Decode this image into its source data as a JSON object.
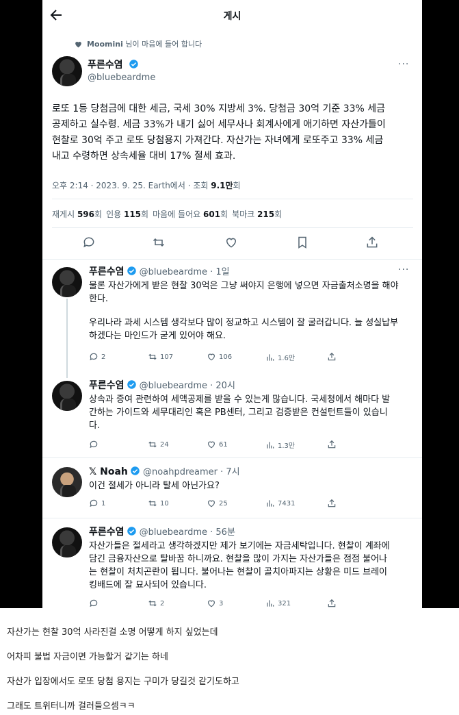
{
  "header": {
    "title": "게시"
  },
  "liked_banner": {
    "user": "Moomini",
    "suffix": "님이 마음에 들어 합니다"
  },
  "main_tweet": {
    "name": "푸른수염",
    "handle": "@bluebeardme",
    "lines": [
      "로또 1등 당첨금에 대한 세금, 국세 30% 지방세 3%. 당첨금 30억 기준 33% 세금",
      "공제하고 실수령. 세금 33%가 내기 싫어 세무사나 회계사에게 애기하면 자산가들이",
      "현찰로 30억 주고 로또 당첨용지 가져간다. 자산가는 자녀에게 로또주고 33% 세금",
      "내고 수령하면 상속세율 대비 17% 절세 효과."
    ],
    "meta_prefix": "오후 2:14 · 2023. 9. 25. Earth에서 · 조회 ",
    "views": "9.1만",
    "views_suffix": "회",
    "stats": {
      "retweet_label": "재게시",
      "retweet_count": "596",
      "retweet_unit": "회",
      "quote_label": "인용",
      "quote_count": "115",
      "quote_unit": "회",
      "like_label": "마음에 들어요",
      "like_count": "601",
      "like_unit": "회",
      "bookmark_label": "북마크",
      "bookmark_count": "215",
      "bookmark_unit": "회"
    }
  },
  "replies": [
    {
      "name": "푸른수염",
      "handle_time": "@bluebeardme · 1일",
      "lines": [
        "물론 자산가에게 받은 현찰 30억은 그냥 써야지 은행에 넣으면 자금출처소명을 해야",
        "한다.",
        "",
        "우리나라 과세 시스템 생각보다 많이 정교하고 시스템이 잘 굴러갑니다. 늘 성실납부",
        "하겠다는 마인드가 굳게 있어야 해요."
      ],
      "counts": {
        "reply": "2",
        "retweet": "107",
        "like": "106",
        "views": "1.6만"
      }
    },
    {
      "name": "푸른수염",
      "handle_time": "@bluebeardme · 20시",
      "lines": [
        "상속과 증여 관련하여 세액공제를 받을 수 있는게 많습니다. 국세청에서 해마다 발",
        "간하는 가이드와 세무대리인 혹은 PB센터, 그리고 검증받은 컨설턴트들이 있습니",
        "다."
      ],
      "counts": {
        "reply": "",
        "retweet": "24",
        "like": "61",
        "views": "1.3만"
      }
    },
    {
      "name": "𝕏 Noah",
      "handle_time": "@noahpdreamer · 7시",
      "lines": [
        "이건 절세가 아니라 탈세 아닌가요?"
      ],
      "counts": {
        "reply": "1",
        "retweet": "10",
        "like": "25",
        "views": "7431"
      }
    },
    {
      "name": "푸른수염",
      "handle_time": "@bluebeardme · 56분",
      "lines": [
        "자산가들은 절세라고 생각하겠지만 제가 보기에는 자금세탁입니다. 현찰이 계좌에",
        "담긴 금융자산으로 탈바꿈 하니까요. 현찰을 많이 가지는 자산가들은 점점 불어나",
        "는 현찰이 처치곤란이 됩니다. 불어나는 현찰이 골치아파지는 상황은 미드 브레이",
        "킹배드에 잘 묘사되어 있습니다."
      ],
      "counts": {
        "reply": "",
        "retweet": "2",
        "like": "3",
        "views": "321"
      }
    }
  ],
  "captions": [
    "자산가는 현찰 30억 사라진걸 소명 어떻게 하지 싶었는데",
    "어차피 불법 자금이면 가능할거 같기는 하네",
    "자산가 입장에서도 로또 당첨 용지는 구미가 당길것 같기도하고",
    "그래도 트위터니까 걸러들으셈ㅋㅋ"
  ],
  "colors": {
    "verified": "#1d9bf0",
    "secondary_text": "#536471"
  }
}
